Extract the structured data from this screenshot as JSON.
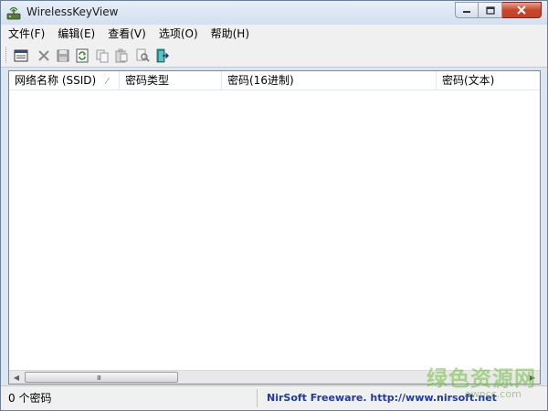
{
  "window": {
    "title": "WirelessKeyView",
    "app_icon": "wifi-app-icon",
    "caption_buttons": [
      "minimize-icon",
      "maximize-icon",
      "close-icon"
    ]
  },
  "menu": {
    "items": [
      {
        "label": "文件(F)"
      },
      {
        "label": "编辑(E)"
      },
      {
        "label": "查看(V)"
      },
      {
        "label": "选项(O)"
      },
      {
        "label": "帮助(H)"
      }
    ]
  },
  "toolbar": {
    "buttons": [
      {
        "icon": "properties-icon"
      },
      {
        "icon": "delete-icon"
      },
      {
        "icon": "save-icon"
      },
      {
        "icon": "refresh-icon"
      },
      {
        "icon": "copy-icon"
      },
      {
        "icon": "paste-icon"
      },
      {
        "icon": "find-icon"
      },
      {
        "icon": "exit-icon"
      }
    ]
  },
  "list": {
    "columns": [
      {
        "label": "网络名称 (SSID)",
        "sorted": true
      },
      {
        "label": "密码类型"
      },
      {
        "label": "密码(16进制)"
      },
      {
        "label": "密码(文本)"
      }
    ],
    "rows": [],
    "scrollbar_grip": "Ⅲ"
  },
  "status": {
    "count_text": "0 个密码",
    "credit_text": "NirSoft Freeware.  http://www.nirsoft.net"
  },
  "watermark": {
    "cn_text": "绿色资源网",
    "url_text": "ownсс.com"
  },
  "colors": {
    "accent_close": "#c9452b",
    "credit_link": "#1d3aa8",
    "watermark_green": "#6ebe3c"
  }
}
